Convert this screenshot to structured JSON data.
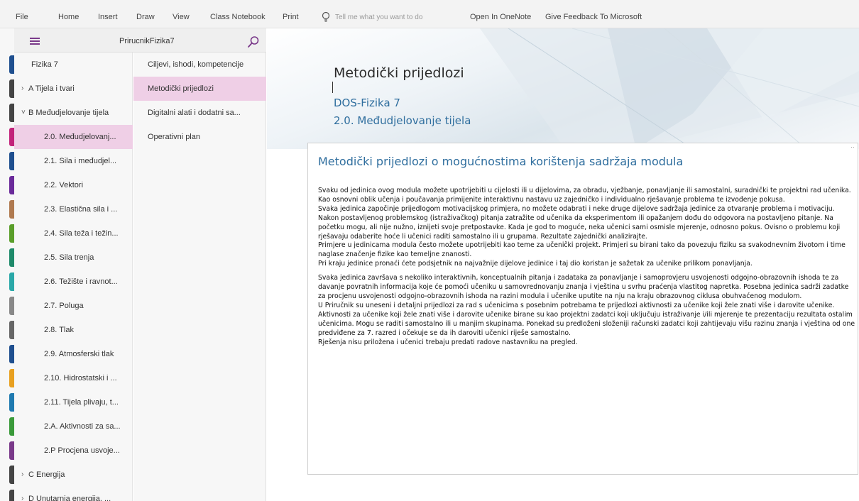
{
  "ribbon": {
    "items": [
      "File",
      "Home",
      "Insert",
      "Draw",
      "View",
      "Class Notebook",
      "Print"
    ],
    "tell_me": "Tell me what you want to do",
    "open_onenote": "Open In OneNote",
    "feedback": "Give Feedback To Microsoft"
  },
  "notebook": {
    "title": "PrirucnikFizika7"
  },
  "colors": {
    "accent": "#7a3a8a",
    "selected_bg": "#efcfe6",
    "heading": "#2f6e9e"
  },
  "sections": [
    {
      "label": "Fizika 7",
      "indent": 0,
      "chevron": ""
    },
    {
      "label": "A Tijela i tvari",
      "indent": 0,
      "chevron": ">"
    },
    {
      "label": "B Međudjelovanje tijela",
      "indent": 0,
      "chevron": "v"
    },
    {
      "label": "2.0. Međudjelovanj...",
      "indent": 1,
      "chevron": "",
      "selected": true
    },
    {
      "label": "2.1. Sila i međudjel...",
      "indent": 1,
      "chevron": ""
    },
    {
      "label": "2.2. Vektori",
      "indent": 1,
      "chevron": ""
    },
    {
      "label": "2.3. Elastična sila i ...",
      "indent": 1,
      "chevron": ""
    },
    {
      "label": "2.4. Sila teža i težin...",
      "indent": 1,
      "chevron": ""
    },
    {
      "label": "2.5. Sila trenja",
      "indent": 1,
      "chevron": ""
    },
    {
      "label": "2.6. Težište i ravnot...",
      "indent": 1,
      "chevron": ""
    },
    {
      "label": "2.7. Poluga",
      "indent": 1,
      "chevron": ""
    },
    {
      "label": "2.8. Tlak",
      "indent": 1,
      "chevron": ""
    },
    {
      "label": "2.9. Atmosferski tlak",
      "indent": 1,
      "chevron": ""
    },
    {
      "label": "2.10. Hidrostatski i ...",
      "indent": 1,
      "chevron": ""
    },
    {
      "label": "2.11. Tijela plivaju, t...",
      "indent": 1,
      "chevron": ""
    },
    {
      "label": "2.A. Aktivnosti za sa...",
      "indent": 1,
      "chevron": ""
    },
    {
      "label": "2.P Procjena usvoje...",
      "indent": 1,
      "chevron": ""
    },
    {
      "label": "C Energija",
      "indent": 0,
      "chevron": ">"
    },
    {
      "label": "D Unutarnja energija, ...",
      "indent": 0,
      "chevron": ">"
    }
  ],
  "section_tab_colors": [
    "#1f4f8f",
    "#444444",
    "#444444",
    "#c2227a",
    "#1f4f8f",
    "#6a2a9a",
    "#b07a50",
    "#5a9e2a",
    "#1e8a6a",
    "#2aa8a8",
    "#888888",
    "#666666",
    "#1f4f8f",
    "#e8a020",
    "#1f7ab0",
    "#3a9a3a",
    "#7a3a8a",
    "#444444",
    "#444444"
  ],
  "pages": [
    {
      "label": "Ciljevi, ishodi, kompetencije"
    },
    {
      "label": "Metodički prijedlozi",
      "selected": true
    },
    {
      "label": "Digitalni alati i dodatni sa..."
    },
    {
      "label": "Operativni plan"
    }
  ],
  "page": {
    "title": "Metodički prijedlozi",
    "subtitle1": "DOS-Fizika 7",
    "subtitle2": "2.0. Međudjelovanje tijela",
    "note_heading": "Metodički prijedlozi o mogućnostima korištenja sadržaja modula",
    "paragraph1": [
      "Svaku od jedinica ovog modula možete upotrijebiti u cijelosti ili u dijelovima, za obradu, vježbanje, ponavljanje ili samostalni, suradnički te projektni rad učenika.",
      "Kao osnovni oblik učenja i poučavanja primijenite interaktivnu nastavu uz zajedničko i individualno rješavanje problema te izvođenje pokusa.",
      "Svaka jedinica započinje prijedlogom motivacijskog primjera, no možete odabrati i neke druge dijelove sadržaja jedinice za otvaranje problema i motivaciju. Nakon postavljenog problemskog (istraživačkog) pitanja zatražite od učenika da eksperimentom ili opažanjem dođu do odgovora na postavljeno pitanje. Na početku mogu, ali nije nužno, iznijeti svoje pretpostavke. Kada je god to moguće, neka učenici sami osmisle mjerenje, odnosno pokus. Ovisno o problemu koji rješavaju odaberite hoće li učenici raditi samostalno ili u grupama. Rezultate zajednički analizirajte.",
      "Primjere u jedinicama modula često možete upotrijebiti kao teme za učenički projekt. Primjeri su birani tako da povezuju fiziku sa svakodnevnim životom i time naglase značenje fizike kao temeljne znanosti.",
      "Pri kraju jedinice pronaći ćete podsjetnik na najvažnije dijelove jedinice i taj dio koristan je sažetak za učenike prilikom ponavljanja."
    ],
    "paragraph2": [
      "Svaka jedinica završava s nekoliko interaktivnih, konceptualnih pitanja i zadataka za ponavljanje i samoprovjeru usvojenosti odgojno-obrazovnih ishoda te za davanje povratnih informacija koje će pomoći učeniku u samovrednovanju znanja i vještina u svrhu praćenja vlastitog napretka. Posebna jedinica sadrži zadatke za procjenu usvojenosti odgojno-obrazovnih ishoda na razini modula i učenike uputite na nju na kraju obrazovnog ciklusa obuhvaćenog modulom.",
      "U Priručnik su uneseni i detaljni prijedlozi za rad s učenicima s posebnim potrebama te prijedlozi aktivnosti za učenike koji žele znati više i darovite učenike.",
      "Aktivnosti za učenike koji žele znati više i darovite učenike birane su kao projektni zadatci koji uključuju istraživanje i/ili mjerenje te prezentaciju rezultata ostalim učenicima. Mogu se raditi samostalno ili u manjim skupinama. Ponekad su predloženi složeniji računski zadatci koji zahtijevaju višu razinu znanja i vještina od one predviđene za 7. razred i očekuje se da ih daroviti učenici riješe samostalno.",
      "Rješenja nisu priložena i učenici trebaju predati radove nastavniku na pregled."
    ]
  }
}
